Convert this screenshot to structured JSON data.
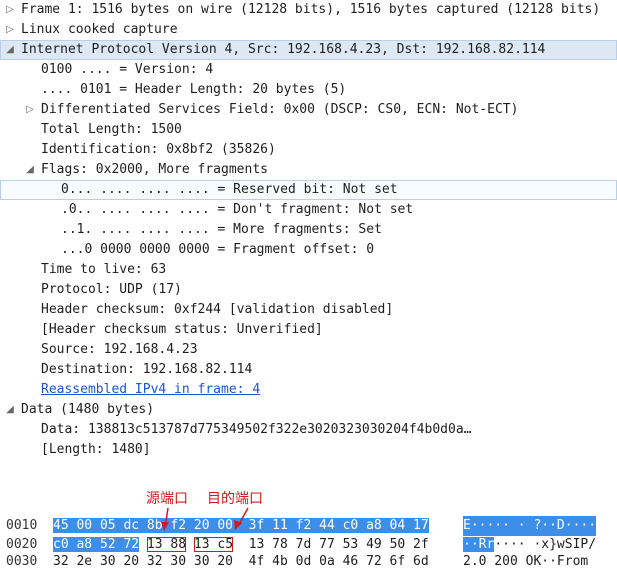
{
  "tree": [
    {
      "text": "Frame 1: 1516 bytes on wire (12128 bits), 1516 bytes captured (12128 bits)",
      "expander": "collapsed"
    },
    {
      "text": "Linux cooked capture",
      "expander": "collapsed"
    },
    {
      "text": "Internet Protocol Version 4, Src: 192.168.4.23, Dst: 192.168.82.114",
      "expander": "expanded"
    },
    {
      "text": "0100 .... = Version: 4",
      "expander": "none"
    },
    {
      "text": ".... 0101 = Header Length: 20 bytes (5)",
      "expander": "none"
    },
    {
      "text": "Differentiated Services Field: 0x00 (DSCP: CS0, ECN: Not-ECT)",
      "expander": "collapsed"
    },
    {
      "text": "Total Length: 1500",
      "expander": "none"
    },
    {
      "text": "Identification: 0x8bf2 (35826)",
      "expander": "none"
    },
    {
      "text": "Flags: 0x2000, More fragments",
      "expander": "expanded"
    },
    {
      "text": "0... .... .... .... = Reserved bit: Not set",
      "expander": "none"
    },
    {
      "text": ".0.. .... .... .... = Don't fragment: Not set",
      "expander": "none"
    },
    {
      "text": "..1. .... .... .... = More fragments: Set",
      "expander": "none"
    },
    {
      "text": "...0 0000 0000 0000 = Fragment offset: 0",
      "expander": "none"
    },
    {
      "text": "Time to live: 63",
      "expander": "none"
    },
    {
      "text": "Protocol: UDP (17)",
      "expander": "none"
    },
    {
      "text": "Header checksum: 0xf244 [validation disabled]",
      "expander": "none"
    },
    {
      "text": "[Header checksum status: Unverified]",
      "expander": "none"
    },
    {
      "text": "Source: 192.168.4.23",
      "expander": "none"
    },
    {
      "text": "Destination: 192.168.82.114",
      "expander": "none"
    },
    {
      "text": "Reassembled IPv4 in frame: 4",
      "expander": "none",
      "link": true
    },
    {
      "text": "Data (1480 bytes)",
      "expander": "expanded"
    },
    {
      "text": "Data: 138813c513787d775349502f322e3020323030204f4b0d0a…",
      "expander": "none"
    },
    {
      "text": "[Length: 1480]",
      "expander": "none"
    }
  ],
  "annotations": {
    "src_port": "源端口",
    "dst_port": "目的端口"
  },
  "hex": {
    "rows": [
      {
        "offset": "0010",
        "b1": "45 00 05 dc 8b f2 20 00",
        "b2": "3f 11 f2 44 c0 a8 04 17",
        "ascii": "E····· · ?··D····"
      },
      {
        "offset": "0020",
        "b1a": "c0 a8 52 72",
        "b1b": "13 88",
        "b1c": "13 c5",
        "b2": "13 78 7d 77 53 49 50 2f",
        "ascii_sel": "··Rr",
        "ascii_rest": "···· ·x}wSIP/"
      },
      {
        "offset": "0030",
        "b1": "32 2e 30 20 32 30 30 20",
        "b2": "4f 4b 0d 0a 46 72 6f 6d",
        "ascii": "2.0 200  OK··From"
      }
    ]
  },
  "colors": {
    "selection": "#3d8ee8",
    "annotation": "#d11a1a",
    "highlight": "#dde8f5"
  }
}
